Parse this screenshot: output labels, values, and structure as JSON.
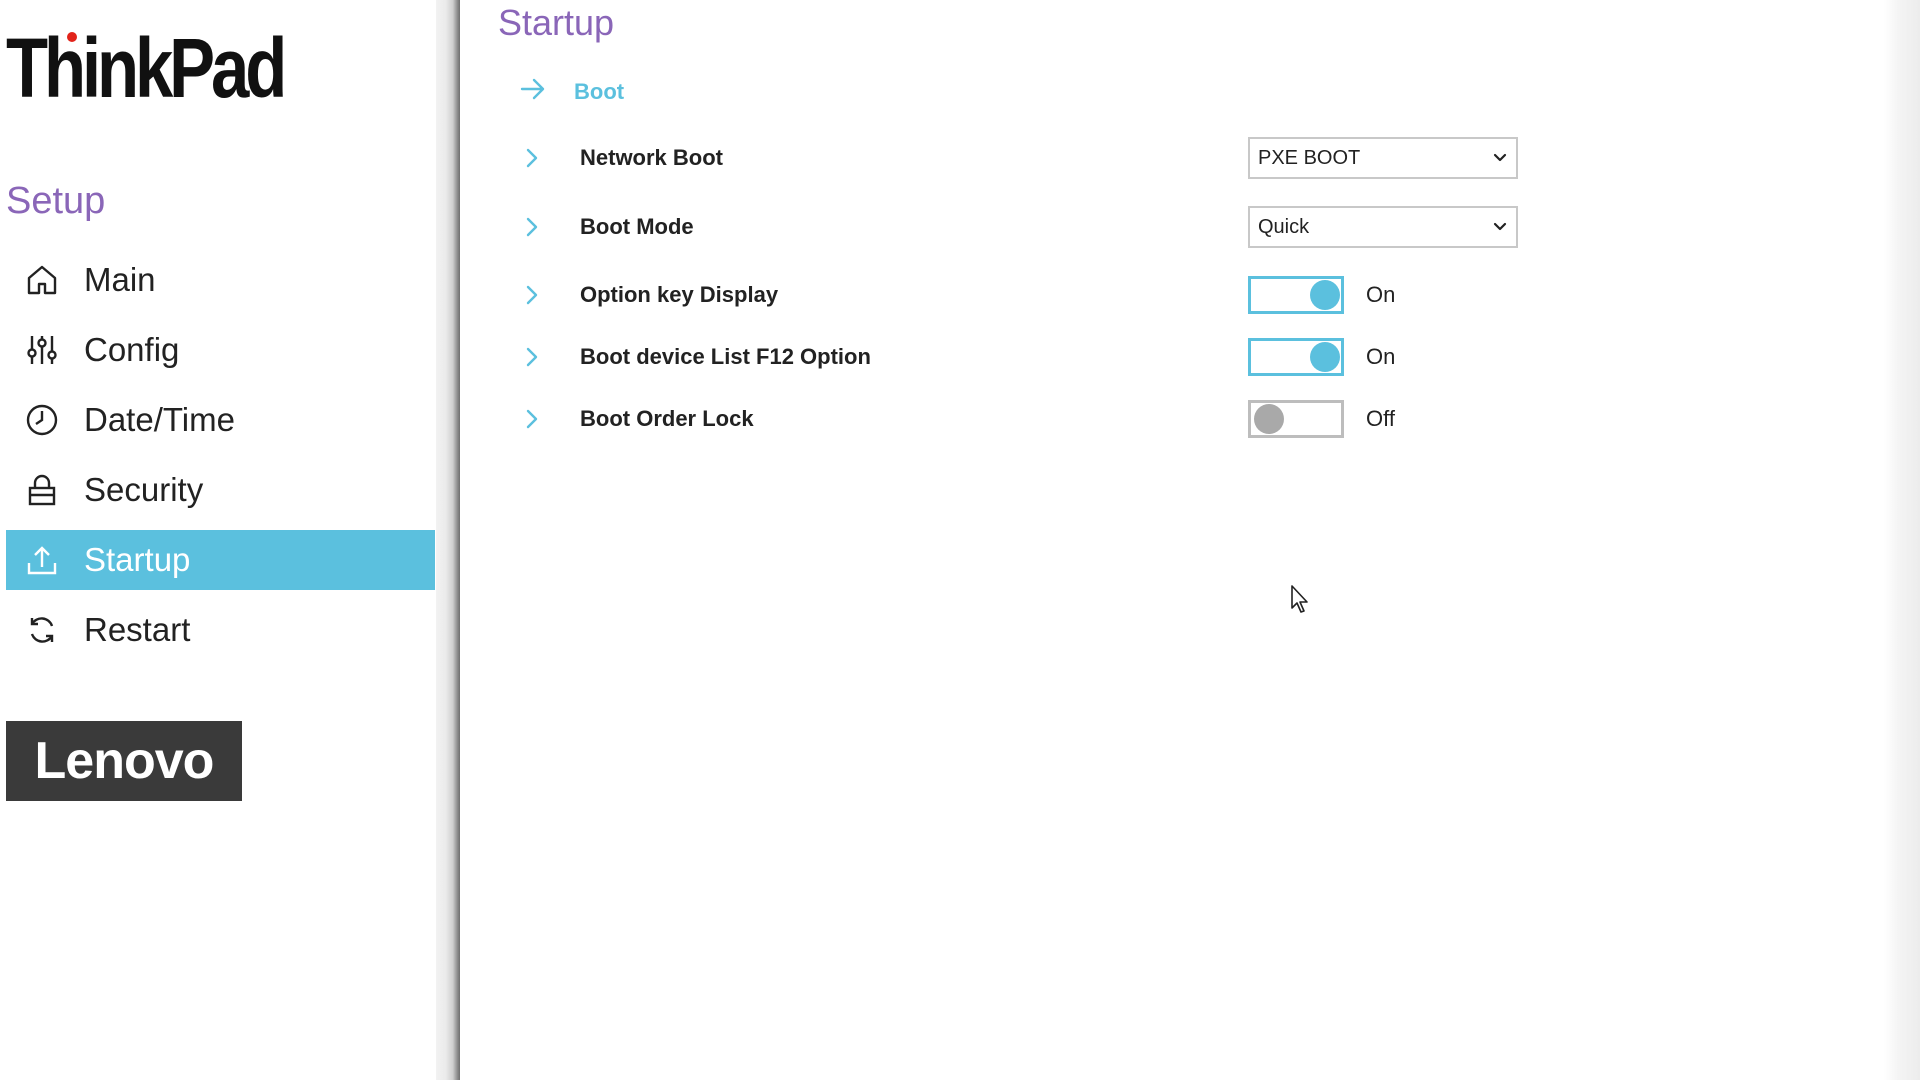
{
  "sidebar": {
    "brand": "ThinkPad",
    "title": "Setup",
    "items": [
      {
        "label": "Main",
        "icon": "home-icon",
        "active": false
      },
      {
        "label": "Config",
        "icon": "sliders-icon",
        "active": false
      },
      {
        "label": "Date/Time",
        "icon": "clock-icon",
        "active": false
      },
      {
        "label": "Security",
        "icon": "lock-icon",
        "active": false
      },
      {
        "label": "Startup",
        "icon": "upload-icon",
        "active": true
      },
      {
        "label": "Restart",
        "icon": "refresh-icon",
        "active": false
      }
    ],
    "lenovo_logo": "Lenovo"
  },
  "main": {
    "title": "Startup",
    "section": "Boot",
    "settings": [
      {
        "label": "Network Boot",
        "type": "select",
        "value": "PXE BOOT"
      },
      {
        "label": "Boot Mode",
        "type": "select",
        "value": "Quick"
      },
      {
        "label": "Option key Display",
        "type": "toggle",
        "state": "On"
      },
      {
        "label": "Boot device List F12 Option",
        "type": "toggle",
        "state": "On"
      },
      {
        "label": "Boot Order Lock",
        "type": "toggle",
        "state": "Off"
      }
    ]
  },
  "colors": {
    "accent": "#5bc0de",
    "title_purple": "#8a66b8",
    "toggle_off": "#a9a9a9"
  }
}
